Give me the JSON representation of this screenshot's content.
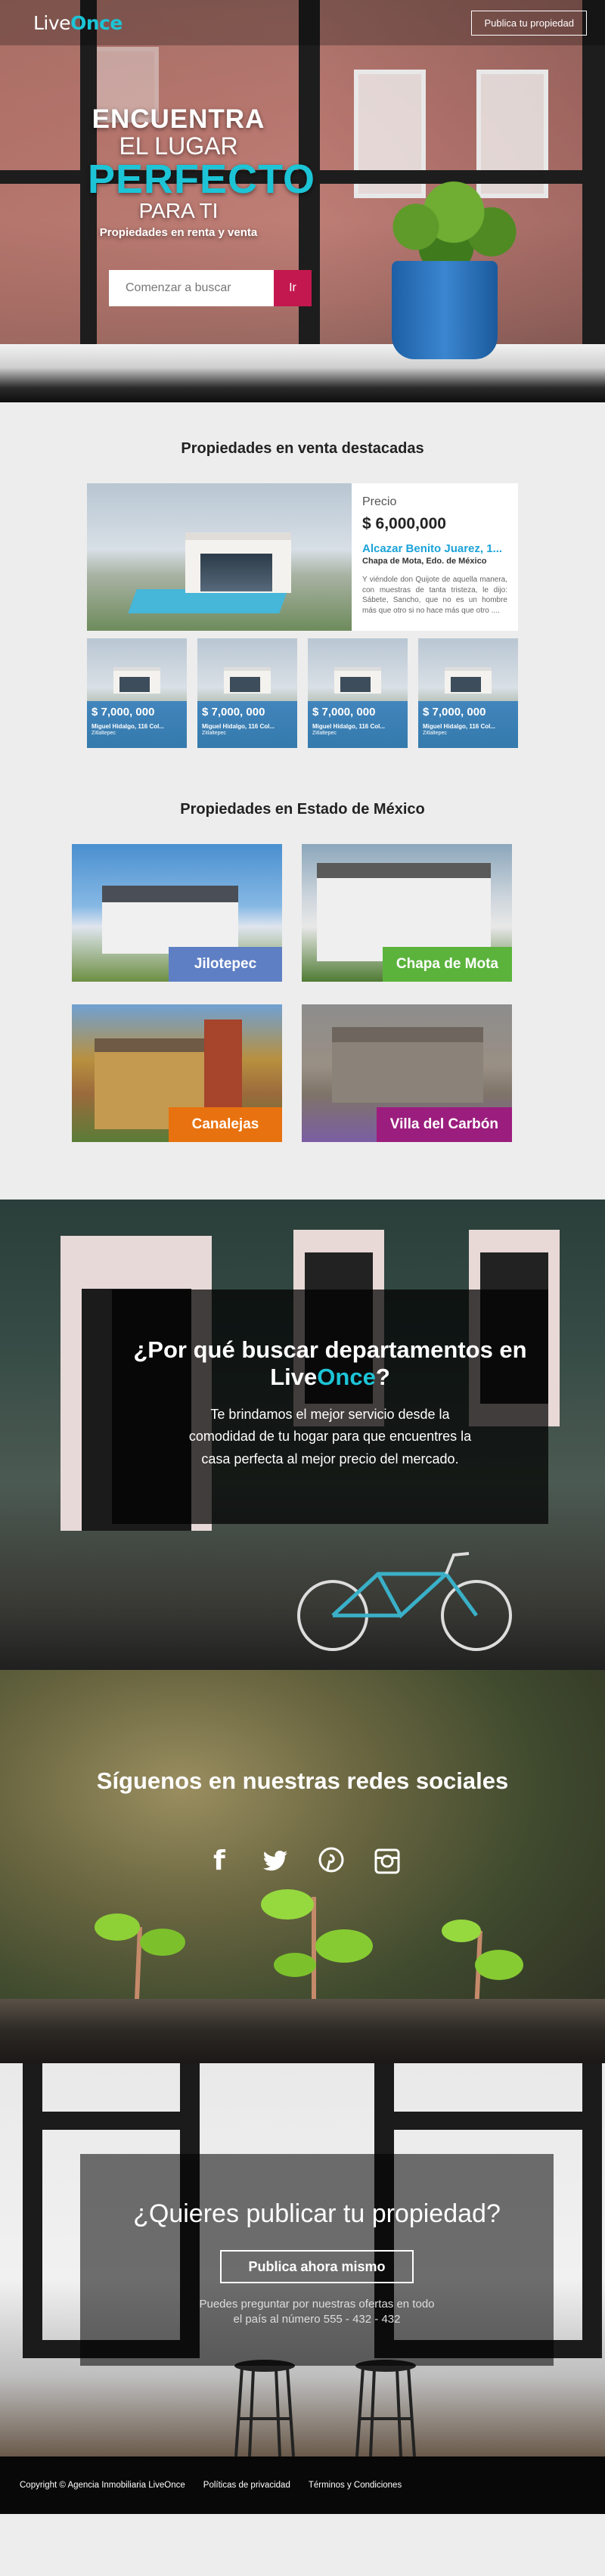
{
  "nav": {
    "logo_part1": "Live",
    "logo_part2": "Once",
    "publish_label": "Publica tu propiedad"
  },
  "hero": {
    "line1": "ENCUENTRA",
    "line2": "EL LUGAR",
    "line3": "PERFECTO",
    "line4": "PARA TI",
    "subtitle": "Propiedades en renta y venta",
    "search_placeholder": "Comenzar a buscar",
    "search_button": "Ir"
  },
  "featured": {
    "title": "Propiedades en venta destacadas",
    "main": {
      "price_label": "Precio",
      "price": "$ 6,000,000",
      "name": "Alcazar Benito Juarez, 1...",
      "location": "Chapa de Mota, Edo. de México",
      "description": "Y viéndole don Quijote de aquella manera, con muestras de tanta tristeza, le dijo: Sábete, Sancho, que no es un hombre más que otro si no hace más que otro ...."
    },
    "cards": [
      {
        "price": "$ 7,000, 000",
        "address": "Miguel Hidalgo, 116 Col...",
        "city": "Zitlaltepec"
      },
      {
        "price": "$ 7,000, 000",
        "address": "Miguel Hidalgo, 116 Col...",
        "city": "Zitlaltepec"
      },
      {
        "price": "$ 7,000, 000",
        "address": "Miguel Hidalgo, 116 Col...",
        "city": "Zitlaltepec"
      },
      {
        "price": "$ 7,000, 000",
        "address": "Miguel Hidalgo, 116 Col...",
        "city": "Zitlaltepec"
      }
    ]
  },
  "region": {
    "title": "Propiedades en  Estado de México",
    "places": [
      {
        "name": "Jilotepec",
        "color": "#5f7fc4"
      },
      {
        "name": "Chapa de Mota",
        "color": "#5bb33c"
      },
      {
        "name": "Canalejas",
        "color": "#e8720f"
      },
      {
        "name": "Villa del Carbón",
        "color": "#9b1e7e"
      }
    ]
  },
  "why": {
    "title_part1": "¿Por qué buscar departamentos en",
    "title_part2": "Live",
    "title_part3": "Once",
    "title_part4": "?",
    "text": "Te brindamos el mejor servicio desde la comodidad de tu hogar para que encuentres la casa perfecta al mejor precio del mercado."
  },
  "social": {
    "title": "Síguenos en nuestras redes sociales",
    "icons": [
      "facebook-icon",
      "twitter-icon",
      "pinterest-icon",
      "instagram-icon"
    ]
  },
  "publish": {
    "title": "¿Quieres publicar tu propiedad?",
    "button": "Publica ahora mismo",
    "text": "Puedes preguntar por nuestras ofertas en todo el país al número 555 - 432 - 432"
  },
  "footer": {
    "copyright": "Copyright ©  Agencia Inmobiliaria LiveOnce",
    "privacy": "Políticas de privacidad",
    "terms": "Términos y Condiciones"
  },
  "colors": {
    "accent": "#1cc4d6",
    "search_button": "#c3184f",
    "card_overlay": "#2878be",
    "link": "#1aa3d8"
  }
}
